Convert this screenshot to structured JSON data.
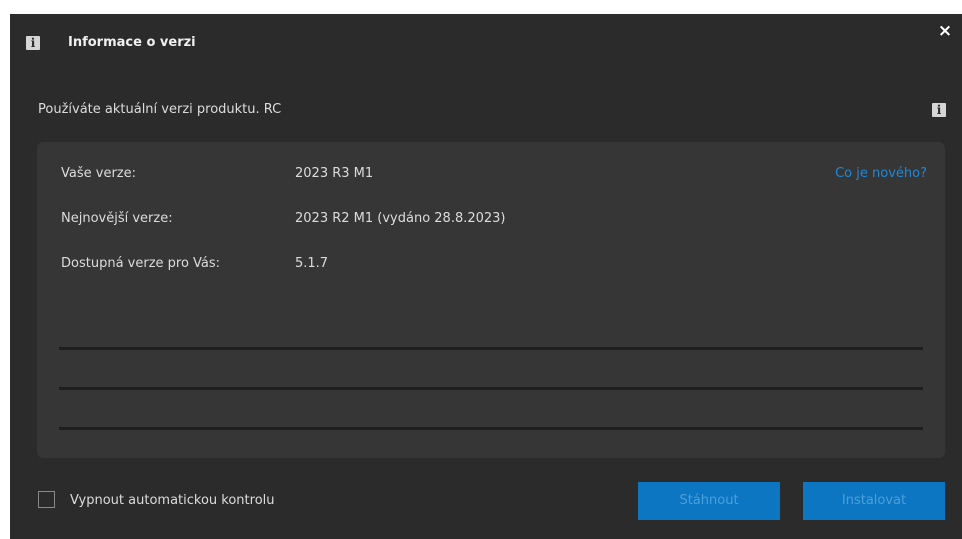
{
  "window": {
    "title": "Informace o verzi",
    "close_glyph": "×"
  },
  "icons": {
    "title": "info-icon",
    "status": "info-icon",
    "close": "close-icon",
    "info_glyph": "i"
  },
  "status": {
    "text": "Používáte aktuální verzi produktu. RC"
  },
  "versions": {
    "rows": [
      {
        "label": "Vaše verze:",
        "value": "2023 R3 M1"
      },
      {
        "label": "Nejnovější verze:",
        "value": "2023 R2 M1 (vydáno 28.8.2023)"
      },
      {
        "label": "Dostupná verze pro Vás:",
        "value": "5.1.7"
      }
    ],
    "whats_new_link": "Co je nového?"
  },
  "footer": {
    "checkbox_label": "Vypnout automatickou kontrolu",
    "checkbox_checked": false,
    "download_label": "Stáhnout",
    "install_label": "Instalovat"
  },
  "colors": {
    "background": "#2b2b2b",
    "panel": "#363636",
    "accent": "#0d76c2",
    "link": "#1e88d8"
  }
}
